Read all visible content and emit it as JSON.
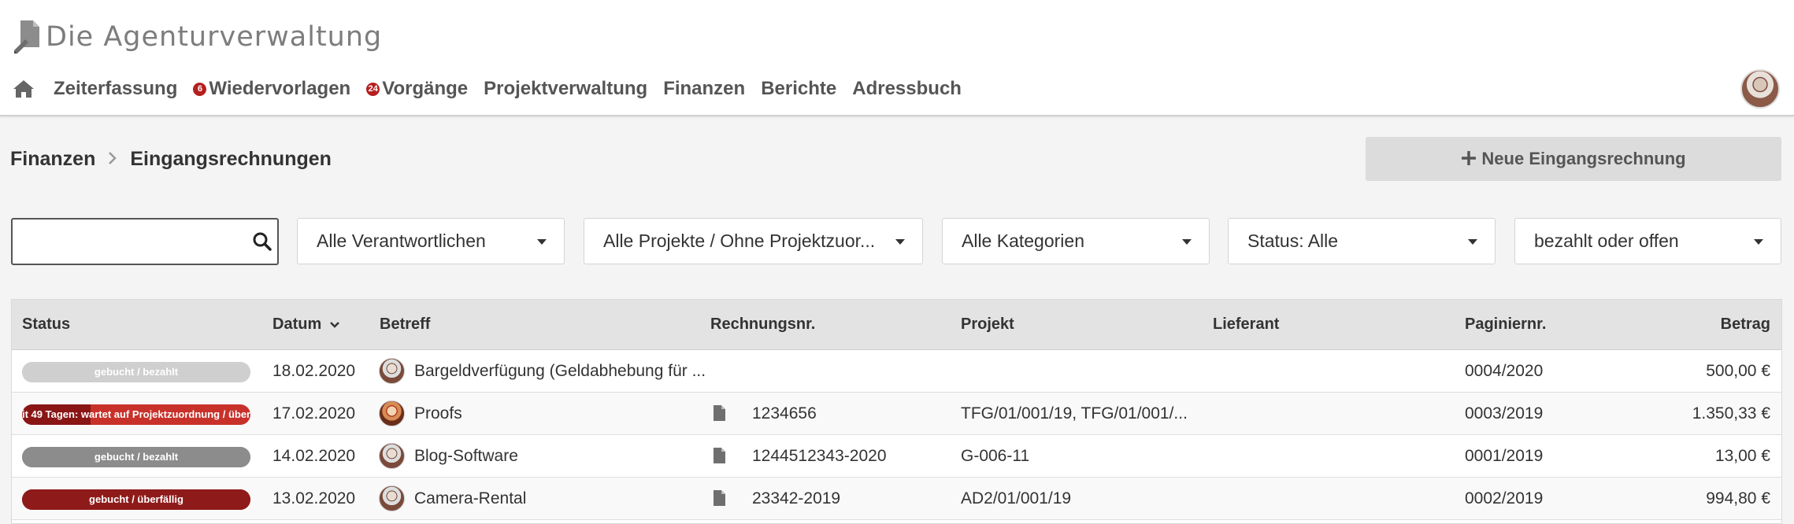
{
  "app": {
    "title": "Die  Agenturverwaltung",
    "logo_icon": "pen-document-logo-icon"
  },
  "nav": {
    "home_icon": "home-icon",
    "items": [
      {
        "label": "Zeiterfassung",
        "badge": ""
      },
      {
        "label": "Wiedervorlagen",
        "badge": "6"
      },
      {
        "label": "Vorgänge",
        "badge": "24"
      },
      {
        "label": "Projektverwaltung",
        "badge": ""
      },
      {
        "label": "Finanzen",
        "badge": ""
      },
      {
        "label": "Berichte",
        "badge": ""
      },
      {
        "label": "Adressbuch",
        "badge": ""
      }
    ],
    "avatar": "user-avatar"
  },
  "breadcrumb": {
    "parent": "Finanzen",
    "current": "Eingangsrechnungen"
  },
  "actions": {
    "new_label": "Neue Eingangsrechnung"
  },
  "filters": {
    "search": {
      "value": "",
      "placeholder": ""
    },
    "responsible": "Alle Verantwortlichen",
    "projects": "Alle Projekte / Ohne Projektzuor...",
    "categories": "Alle Kategorien",
    "status": "Status: Alle",
    "payment": "bezahlt oder offen"
  },
  "table": {
    "columns": {
      "status": "Status",
      "date": "Datum",
      "subject": "Betreff",
      "invoice_no": "Rechnungsnr.",
      "project": "Projekt",
      "supplier": "Lieferant",
      "pagination_no": "Paginiernr.",
      "amount": "Betrag"
    },
    "sort_column": "Datum",
    "rows": [
      {
        "status": "gebucht / bezahlt",
        "status_color": "#cfcfcf",
        "status_fill_color": "#cfcfcf",
        "status_progress": 1.0,
        "date": "18.02.2020",
        "subject": "Bargeldverfügung (Geldabhebung für ...",
        "has_document": false,
        "invoice_no": "",
        "project": "",
        "supplier": "",
        "pagination_no": "0004/2020",
        "amount": "500,00 €"
      },
      {
        "status": "it 49 Tagen: wartet auf Projektzuordnung / über",
        "status_color": "#c8312a",
        "status_fill_color": "#8a1515",
        "status_progress": 0.3,
        "date": "17.02.2020",
        "subject": "Proofs",
        "has_document": true,
        "invoice_no": "1234656",
        "project": "TFG/01/001/19, TFG/01/001/...",
        "supplier": "",
        "pagination_no": "0003/2019",
        "amount": "1.350,33 €"
      },
      {
        "status": "gebucht / bezahlt",
        "status_color": "#8c8c8c",
        "status_fill_color": "#8c8c8c",
        "status_progress": 1.0,
        "date": "14.02.2020",
        "subject": "Blog-Software",
        "has_document": true,
        "invoice_no": "1244512343-2020",
        "project": "G-006-11",
        "supplier": "",
        "pagination_no": "0001/2019",
        "amount": "13,00 €"
      },
      {
        "status": "gebucht / überfällig",
        "status_color": "#8f1a1a",
        "status_fill_color": "#8f1a1a",
        "status_progress": 1.0,
        "date": "13.02.2020",
        "subject": "Camera-Rental",
        "has_document": true,
        "invoice_no": "23342-2019",
        "project": "AD2/01/001/19",
        "supplier": "",
        "pagination_no": "0002/2019",
        "amount": "994,80 €"
      }
    ]
  }
}
